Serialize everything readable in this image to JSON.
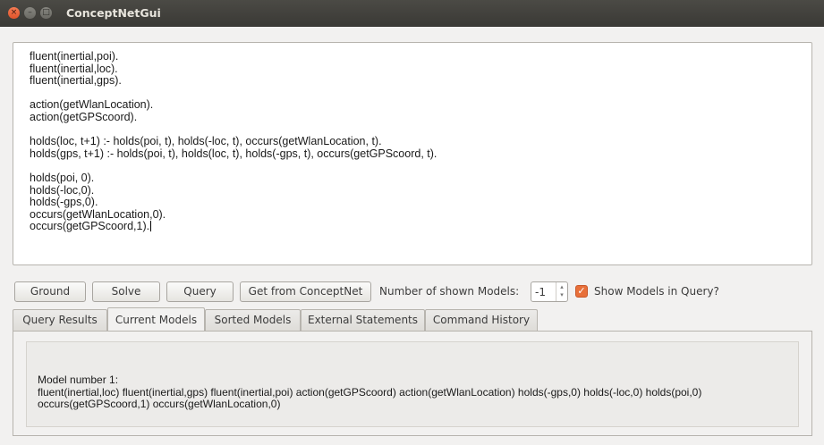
{
  "window": {
    "title": "ConceptNetGui",
    "close_glyph": "×",
    "minimize_glyph": "–",
    "maximize_glyph": "□"
  },
  "editor": {
    "text": "fluent(inertial,poi).\nfluent(inertial,loc).\nfluent(inertial,gps).\n\naction(getWlanLocation).\naction(getGPScoord).\n\nholds(loc, t+1) :- holds(poi, t), holds(-loc, t), occurs(getWlanLocation, t).\nholds(gps, t+1) :- holds(poi, t), holds(loc, t), holds(-gps, t), occurs(getGPScoord, t).\n\nholds(poi, 0).\nholds(-loc,0).\nholds(-gps,0).\noccurs(getWlanLocation,0).\noccurs(getGPScoord,1)."
  },
  "toolbar": {
    "ground_label": "Ground",
    "solve_label": "Solve",
    "query_label": "Query",
    "conceptnet_label": "Get from ConceptNet",
    "models_label": "Number of shown Models:",
    "models_value": "-1",
    "spin_arrows": "▴\n▾",
    "show_models_label": "Show Models in Query?",
    "show_models_checked": true,
    "check_glyph": "✓"
  },
  "tabs": [
    {
      "label": "Query Results",
      "active": false
    },
    {
      "label": "Current Models",
      "active": true
    },
    {
      "label": "Sorted Models",
      "active": false
    },
    {
      "label": "External Statements",
      "active": false
    },
    {
      "label": "Command History",
      "active": false
    }
  ],
  "results": {
    "heading": "Model number 1:",
    "body": "fluent(inertial,loc) fluent(inertial,gps) fluent(inertial,poi) action(getGPScoord) action(getWlanLocation) holds(-gps,0) holds(-loc,0) holds(poi,0) occurs(getGPScoord,1) occurs(getWlanLocation,0)"
  },
  "colors": {
    "accent": "#e8703a",
    "titlebar": "#3c3b37",
    "window_bg": "#f2f1f0"
  }
}
